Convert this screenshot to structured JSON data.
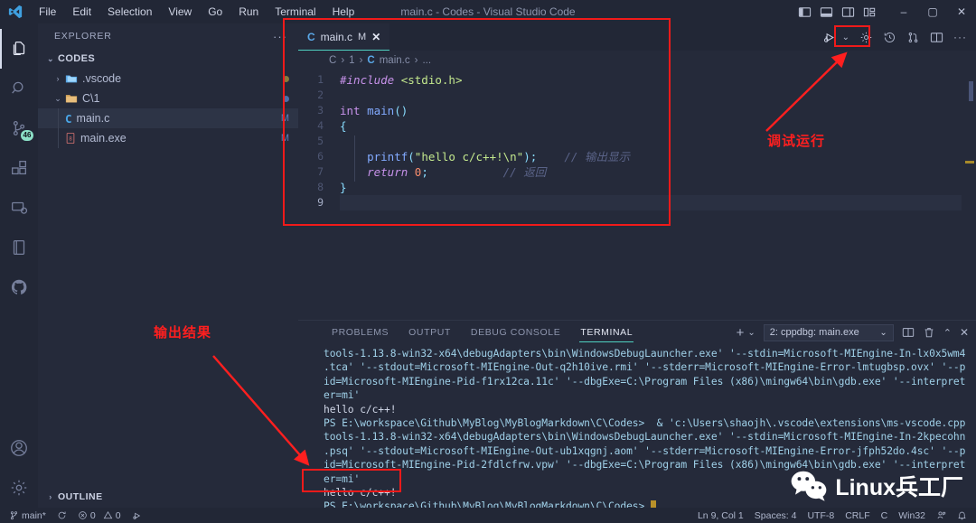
{
  "window": {
    "title": "main.c - Codes - Visual Studio Code",
    "minimize": "–",
    "maximize": "▢",
    "close": "✕"
  },
  "menu": {
    "items": [
      "File",
      "Edit",
      "Selection",
      "View",
      "Go",
      "Run",
      "Terminal",
      "Help"
    ]
  },
  "activity_bar": {
    "items": [
      {
        "name": "explorer",
        "icon": "files-icon"
      },
      {
        "name": "search",
        "icon": "search-icon"
      },
      {
        "name": "source-control",
        "icon": "source-control-icon",
        "badge": "46"
      },
      {
        "name": "extensions",
        "icon": "extensions-icon"
      },
      {
        "name": "remote-explorer",
        "icon": "remote-icon"
      },
      {
        "name": "library",
        "icon": "book-icon"
      },
      {
        "name": "github",
        "icon": "github-icon"
      },
      {
        "name": "accounts",
        "icon": "account-icon"
      },
      {
        "name": "settings",
        "icon": "gear-icon"
      }
    ]
  },
  "sidebar": {
    "header": "EXPLORER",
    "more": "···",
    "root": "CODES",
    "outline": "OUTLINE",
    "items": [
      {
        "label": ".vscode",
        "icon": "folder-vscode-icon",
        "expanded": false,
        "badge": "",
        "depth": 1
      },
      {
        "label": "C\\1",
        "icon": "folder-icon",
        "expanded": true,
        "badge": "",
        "depth": 1
      },
      {
        "label": "main.c",
        "icon": "c-file-icon",
        "badge": "M",
        "depth": 2,
        "selected": true
      },
      {
        "label": "main.exe",
        "icon": "binary-file-icon",
        "badge": "M",
        "depth": 2,
        "selected": false
      }
    ]
  },
  "editor": {
    "tab": {
      "label": "main.c",
      "icon": "c-file-icon",
      "dirty_marker": "M",
      "close": "✕"
    },
    "breadcrumb": [
      "C",
      "1",
      "main.c",
      "..."
    ],
    "actions": [
      {
        "name": "run-and-debug",
        "icon": "run-debug-icon"
      },
      {
        "name": "run-debug-dropdown",
        "icon": "chevron-down-icon"
      },
      {
        "name": "settings",
        "icon": "gear-icon"
      },
      {
        "name": "timeline",
        "icon": "history-icon"
      },
      {
        "name": "source-control-graph",
        "icon": "git-compare-icon"
      },
      {
        "name": "split-editor",
        "icon": "split-editor-icon"
      },
      {
        "name": "more-actions",
        "icon": "ellipsis-icon"
      }
    ],
    "code_lines": [
      {
        "n": "1",
        "tokens": [
          {
            "t": "#include ",
            "c": "pre"
          },
          {
            "t": "<stdio.h>",
            "c": "inc"
          }
        ]
      },
      {
        "n": "2",
        "tokens": []
      },
      {
        "n": "3",
        "tokens": [
          {
            "t": "int ",
            "c": "kw2"
          },
          {
            "t": "main",
            "c": "fn"
          },
          {
            "t": "()",
            "c": "pun"
          }
        ]
      },
      {
        "n": "4",
        "tokens": [
          {
            "t": "{",
            "c": "pun"
          }
        ]
      },
      {
        "n": "5",
        "tokens": []
      },
      {
        "n": "6",
        "tokens": [
          {
            "t": "    ",
            "c": "plain"
          },
          {
            "t": "printf",
            "c": "fn"
          },
          {
            "t": "(",
            "c": "pun"
          },
          {
            "t": "\"hello c/c++!\\n\"",
            "c": "str"
          },
          {
            "t": ");",
            "c": "pun"
          },
          {
            "t": "    ",
            "c": "plain"
          },
          {
            "t": "// 输出显示",
            "c": "cmt"
          }
        ]
      },
      {
        "n": "7",
        "tokens": [
          {
            "t": "    ",
            "c": "plain"
          },
          {
            "t": "return ",
            "c": "kw"
          },
          {
            "t": "0",
            "c": "num"
          },
          {
            "t": ";",
            "c": "pun"
          },
          {
            "t": "           ",
            "c": "plain"
          },
          {
            "t": "// 返回",
            "c": "cmt"
          }
        ]
      },
      {
        "n": "8",
        "tokens": [
          {
            "t": "}",
            "c": "pun"
          }
        ]
      },
      {
        "n": "9",
        "tokens": [],
        "current": true
      }
    ]
  },
  "panel": {
    "tabs": [
      "PROBLEMS",
      "OUTPUT",
      "DEBUG CONSOLE",
      "TERMINAL"
    ],
    "active_tab": "TERMINAL",
    "new_terminal": "+",
    "terminal_selected": "2: cppdbg: main.exe",
    "actions": [
      {
        "name": "new-terminal",
        "icon": "plus-icon"
      },
      {
        "name": "new-terminal-dropdown",
        "icon": "chevron-down-icon"
      },
      {
        "name": "split-terminal",
        "icon": "split-icon"
      },
      {
        "name": "kill-terminal",
        "icon": "trash-icon"
      },
      {
        "name": "maximize-panel",
        "icon": "chevron-up-icon"
      },
      {
        "name": "close-panel",
        "icon": "close-icon"
      }
    ],
    "terminal_lines": [
      {
        "text": "tools-1.13.8-win32-x64\\debugAdapters\\bin\\WindowsDebugLauncher.exe' '--stdin=Microsoft-MIEngine-In-lx0x5wm4",
        "kind": "cmd"
      },
      {
        "text": ".tca' '--stdout=Microsoft-MIEngine-Out-q2h10ive.rmi' '--stderr=Microsoft-MIEngine-Error-lmtugbsp.ovx' '--p",
        "kind": "cmd"
      },
      {
        "text": "id=Microsoft-MIEngine-Pid-f1rx12ca.11c' '--dbgExe=C:\\Program Files (x86)\\mingw64\\bin\\gdb.exe' '--interpret",
        "kind": "cmd"
      },
      {
        "text": "er=mi'",
        "kind": "cmd"
      },
      {
        "text": "hello c/c++!",
        "kind": "out"
      },
      {
        "text": "PS E:\\workspace\\Github\\MyBlog\\MyBlogMarkdown\\C\\Codes>  & 'c:\\Users\\shaojh\\.vscode\\extensions\\ms-vscode.cpp",
        "kind": "cmd"
      },
      {
        "text": "tools-1.13.8-win32-x64\\debugAdapters\\bin\\WindowsDebugLauncher.exe' '--stdin=Microsoft-MIEngine-In-2kpecohn",
        "kind": "cmd"
      },
      {
        "text": ".psq' '--stdout=Microsoft-MIEngine-Out-ub1xqgnj.aom' '--stderr=Microsoft-MIEngine-Error-jfph52do.4sc' '--p",
        "kind": "cmd"
      },
      {
        "text": "id=Microsoft-MIEngine-Pid-2fdlcfrw.vpw' '--dbgExe=C:\\Program Files (x86)\\mingw64\\bin\\gdb.exe' '--interpret",
        "kind": "cmd"
      },
      {
        "text": "er=mi'",
        "kind": "cmd"
      },
      {
        "text": "hello c/c++!",
        "kind": "out"
      },
      {
        "text": "PS E:\\workspace\\Github\\MyBlog\\MyBlogMarkdown\\C\\Codes> ",
        "kind": "cmd",
        "caret": true
      }
    ]
  },
  "status_bar": {
    "branch": "main*",
    "sync": "sync-icon",
    "errors": "0",
    "warnings": "0",
    "ports": "ports-icon",
    "position": "Ln 9, Col 1",
    "indent": "Spaces: 4",
    "encoding": "UTF-8",
    "eol": "CRLF",
    "language": "C",
    "platform": "Win32",
    "feedback": "feedback-icon",
    "bell": "bell-icon"
  },
  "annotations": [
    {
      "name": "debug-run-annotation",
      "text": "调试运行",
      "color": "#ff1f1f"
    },
    {
      "name": "output-result-annotation",
      "text": "输出结果",
      "color": "#ff1f1f"
    }
  ],
  "watermark": {
    "text": "Linux兵工厂",
    "icon": "wechat-icon"
  },
  "colors": {
    "accent": "#4fd0c0",
    "annotation_red": "#ff1f1f",
    "editor_bg": "#252a3a",
    "titlebar_bg": "#222736",
    "badge_green": "#8ce0c7"
  }
}
